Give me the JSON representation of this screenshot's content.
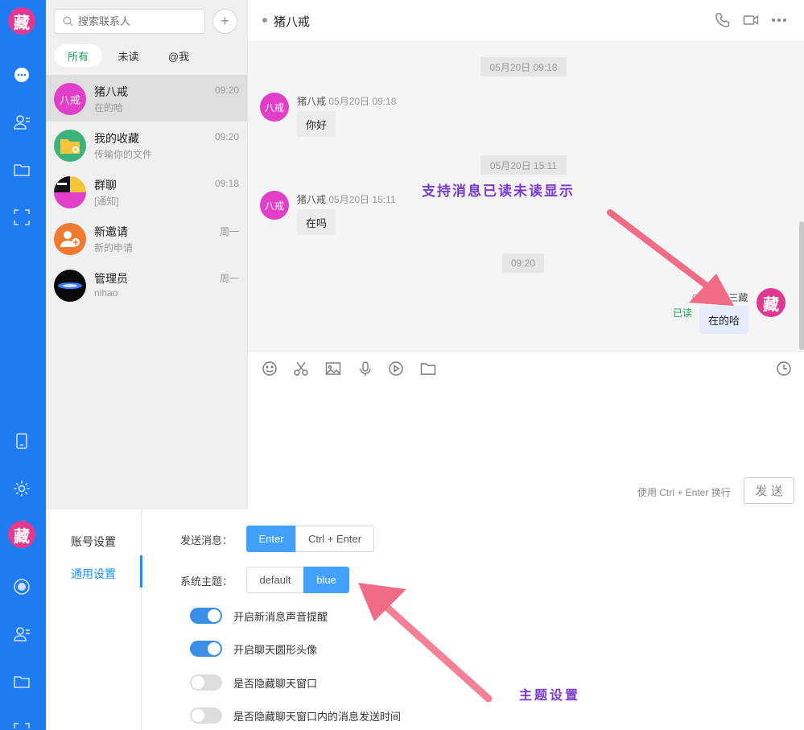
{
  "rail": {
    "logo": "藏",
    "icons": [
      "chat-icon",
      "contacts-icon",
      "folder-icon",
      "scan-icon",
      "phone-icon",
      "gear-icon"
    ]
  },
  "search": {
    "placeholder": "搜索联系人",
    "add": "+"
  },
  "filters": [
    "所有",
    "未读",
    "@我"
  ],
  "contacts": [
    {
      "name": "猪八戒",
      "msg": "在的哈",
      "time": "09:20",
      "avatar_text": "八戒"
    },
    {
      "name": "我的收藏",
      "msg": "传输你的文件",
      "time": "09:20"
    },
    {
      "name": "群聊",
      "msg": "[通知]",
      "time": "09:18"
    },
    {
      "name": "新邀请",
      "msg": "新的申请",
      "time": "周一"
    },
    {
      "name": "管理员",
      "msg": "nihao",
      "time": "周一"
    }
  ],
  "chat": {
    "title": "猪八戒",
    "messages": [
      {
        "timestamp": "05月20日 09:18",
        "sender": "猪八戒",
        "time": "05月20日 09:18",
        "text": "你好",
        "avatar": "八戒"
      },
      {
        "timestamp": "05月20日 15:11",
        "sender": "猪八戒",
        "time": "05月20日 15:11",
        "text": "在吗",
        "avatar": "八戒"
      },
      {
        "timestamp": "09:20",
        "sender": "唐三藏",
        "time": "09:20",
        "text": "在的哈",
        "read": "已读",
        "avatar": "藏"
      }
    ],
    "annotation": "支持消息已读未读显示",
    "hint": "使用 Ctrl + Enter 换行",
    "send": "发 送"
  },
  "settings": {
    "menu": [
      "账号设置",
      "通用设置"
    ],
    "send_label": "发送消息：",
    "send_options": [
      "Enter",
      "Ctrl + Enter"
    ],
    "theme_label": "系统主题：",
    "theme_options": [
      "default",
      "blue"
    ],
    "toggles": [
      {
        "label": "开启新消息声音提醒",
        "on": true
      },
      {
        "label": "开启聊天圆形头像",
        "on": true
      },
      {
        "label": "是否隐藏聊天窗口",
        "on": false
      },
      {
        "label": "是否隐藏聊天窗口内的消息发送时间",
        "on": false
      }
    ],
    "annotation": "主题设置"
  },
  "colors": {
    "rail": "#1f7bf0",
    "accent": "#42a0ff",
    "read": "#18a058",
    "arrow": "#f06c86"
  }
}
